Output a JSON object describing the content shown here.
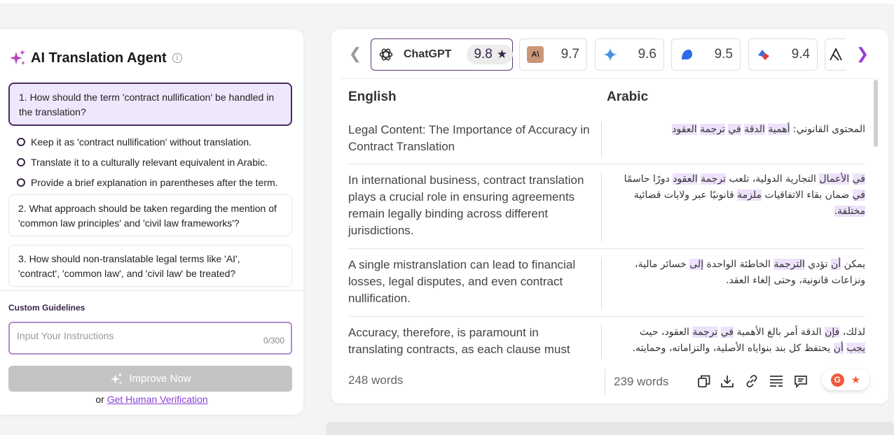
{
  "left": {
    "title": "AI Translation Agent",
    "info": "i",
    "questions": [
      {
        "text": "1. How should the term 'contract nullification' be handled in the translation?"
      },
      {
        "text": "2. What approach should be taken regarding the mention of 'common law principles' and 'civil law frameworks'?"
      },
      {
        "text": "3. How should non-translatable legal terms like 'AI', 'contract', 'common law', and 'civil law' be treated?"
      }
    ],
    "options": [
      "Keep it as 'contract nullification' without translation.",
      "Translate it to a culturally relevant equivalent in Arabic.",
      "Provide a brief explanation in parentheses after the term."
    ],
    "custom_label": "Custom Guidelines",
    "input_placeholder": "Input Your Instructions",
    "input_count": "0/300",
    "improve_label": "Improve Now",
    "verify_prefix": "or",
    "verify_link": "Get Human Verification"
  },
  "models": [
    {
      "name": "ChatGPT",
      "score": "9.8",
      "icon": "chatgpt-icon",
      "selected": true
    },
    {
      "score": "9.7",
      "icon": "anthropic-icon"
    },
    {
      "score": "9.6",
      "icon": "gemini-icon"
    },
    {
      "score": "9.5",
      "icon": "blue-blob-icon"
    },
    {
      "score": "9.4",
      "icon": "red-diamond-icon"
    }
  ],
  "columns": {
    "source": "English",
    "target": "Arabic"
  },
  "rows": [
    {
      "en": "Legal Content: The Importance of Accuracy in Contract Translation",
      "ar": "المحتوى القانوني: أهمية الدقة في ترجمة العقود"
    },
    {
      "en": "In international business, contract translation plays a crucial role in ensuring agreements remain legally binding across different jurisdictions.",
      "ar": "في الأعمال التجارية الدولية، تلعب ترجمة العقود دورًا حاسمًا في ضمان بقاء الاتفاقيات ملزمة قانونيًا عبر ولايات قضائية مختلفة."
    },
    {
      "en": "A single mistranslation can lead to financial losses, legal disputes, and even contract nullification.",
      "ar": "يمكن أن تؤدي الترجمة الخاطئة الواحدة إلى خسائر مالية، ونزاعات قانونية، وحتى إلغاء العقد."
    },
    {
      "en": "Accuracy, therefore, is paramount in translating contracts, as each clause must",
      "ar": "لذلك، فإن الدقة أمر بالغ الأهمية في ترجمة العقود، حيث يجب أن يحتفظ كل بند بنواياه الأصلية، والتزاماته، وحمايته."
    }
  ],
  "footer": {
    "en_words": "248 words",
    "ar_words": "239 words",
    "tools": [
      "copy-icon",
      "download-icon",
      "link-icon",
      "align-icon",
      "comment-icon"
    ]
  },
  "colors": {
    "accent": "#9b3fd9",
    "dark": "#3a2449",
    "highlight": "#ede1fb"
  }
}
